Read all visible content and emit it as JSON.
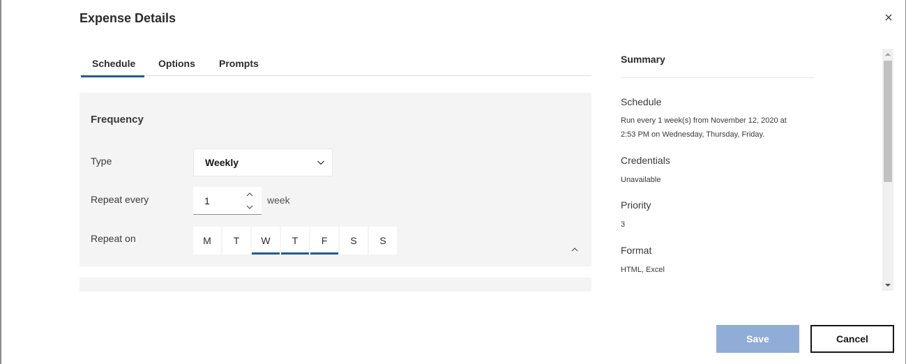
{
  "dialog": {
    "title": "Expense Details",
    "close_icon": "close-icon"
  },
  "tabs": [
    {
      "label": "Schedule",
      "active": true
    },
    {
      "label": "Options",
      "active": false
    },
    {
      "label": "Prompts",
      "active": false
    }
  ],
  "frequency": {
    "title": "Frequency",
    "type_label": "Type",
    "type_value": "Weekly",
    "repeat_every_label": "Repeat every",
    "repeat_every_value": "1",
    "repeat_every_unit": "week",
    "repeat_on_label": "Repeat on",
    "days": [
      {
        "label": "M",
        "selected": false
      },
      {
        "label": "T",
        "selected": false
      },
      {
        "label": "W",
        "selected": true
      },
      {
        "label": "T",
        "selected": true
      },
      {
        "label": "F",
        "selected": true
      },
      {
        "label": "S",
        "selected": false
      },
      {
        "label": "S",
        "selected": false
      }
    ]
  },
  "summary": {
    "title": "Summary",
    "schedule_label": "Schedule",
    "schedule_value_line1": "Run every 1 week(s) from November 12, 2020 at",
    "schedule_value_line2": "2:53 PM on Wednesday, Thursday, Friday.",
    "credentials_label": "Credentials",
    "credentials_value": "Unavailable",
    "priority_label": "Priority",
    "priority_value": "3",
    "format_label": "Format",
    "format_value": "HTML, Excel"
  },
  "footer": {
    "save_label": "Save",
    "cancel_label": "Cancel"
  },
  "colors": {
    "accent": "#1f5a9a",
    "save_disabled": "#8fadd6",
    "panel_bg": "#f4f4f4"
  }
}
